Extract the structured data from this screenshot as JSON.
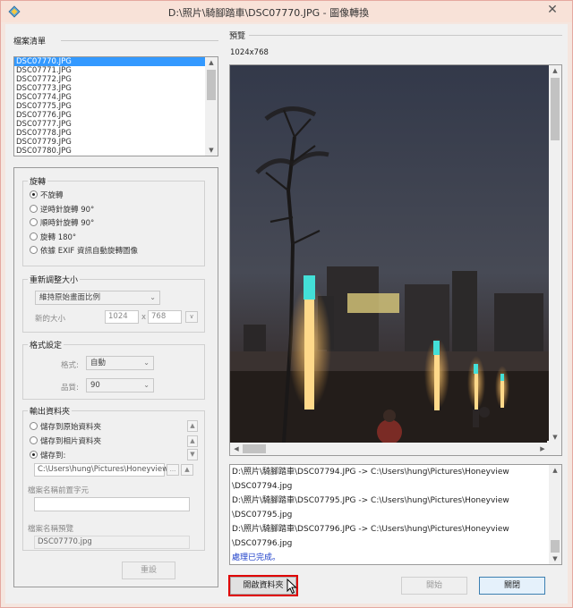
{
  "window": {
    "title": "D:\\照片\\騎腳踏車\\DSC07770.JPG - 圖像轉換",
    "close_symbol": "✕"
  },
  "file_list": {
    "label": "檔案清單",
    "items": [
      "DSC07770.JPG",
      "DSC07771.JPG",
      "DSC07772.JPG",
      "DSC07773.JPG",
      "DSC07774.JPG",
      "DSC07775.JPG",
      "DSC07776.JPG",
      "DSC07777.JPG",
      "DSC07778.JPG",
      "DSC07779.JPG",
      "DSC07780.JPG"
    ],
    "selected_index": 0
  },
  "rotate": {
    "title": "旋轉",
    "options": [
      "不旋轉",
      "逆時針旋轉 90°",
      "順時針旋轉 90°",
      "旋轉 180°",
      "依據 EXIF 資訊自動旋轉圖像"
    ],
    "selected_index": 0
  },
  "resize": {
    "title": "重新調整大小",
    "mode": "維持原始畫面比例",
    "new_size_label": "新的大小",
    "width": "1024",
    "times": "x",
    "height": "768",
    "unit_symbol": "∨"
  },
  "format": {
    "title": "格式設定",
    "format_label": "格式:",
    "format_value": "自動",
    "quality_label": "品質:",
    "quality_value": "90"
  },
  "output": {
    "title": "輸出資料夾",
    "options": [
      "儲存到原始資料夾",
      "儲存到相片資料夾",
      "儲存到:"
    ],
    "selected_index": 2,
    "path": "C:\\Users\\hung\\Pictures\\Honeyview",
    "browse_label": "...",
    "prefix_label": "檔案名稱前置字元",
    "prefix_value": "",
    "preview_label": "檔案名稱預覽",
    "preview_value": "DSC07770.jpg"
  },
  "reset_label": "重設",
  "preview": {
    "label": "預覽",
    "dimensions": "1024x768"
  },
  "log": {
    "lines": [
      "D:\\照片\\騎腳踏車\\DSC07794.JPG -> C:\\Users\\hung\\Pictures\\Honeyview",
      "\\DSC07794.jpg",
      "D:\\照片\\騎腳踏車\\DSC07795.JPG -> C:\\Users\\hung\\Pictures\\Honeyview",
      "\\DSC07795.jpg",
      "D:\\照片\\騎腳踏車\\DSC07796.JPG -> C:\\Users\\hung\\Pictures\\Honeyview",
      "\\DSC07796.jpg"
    ],
    "done_text": "處理已完成。"
  },
  "buttons": {
    "open_folder": "開啟資料夾",
    "start": "開始",
    "close": "關閉"
  },
  "colors": {
    "selection": "#3399ff",
    "highlight_box": "#e00000",
    "done_text": "#1a3cc9"
  }
}
